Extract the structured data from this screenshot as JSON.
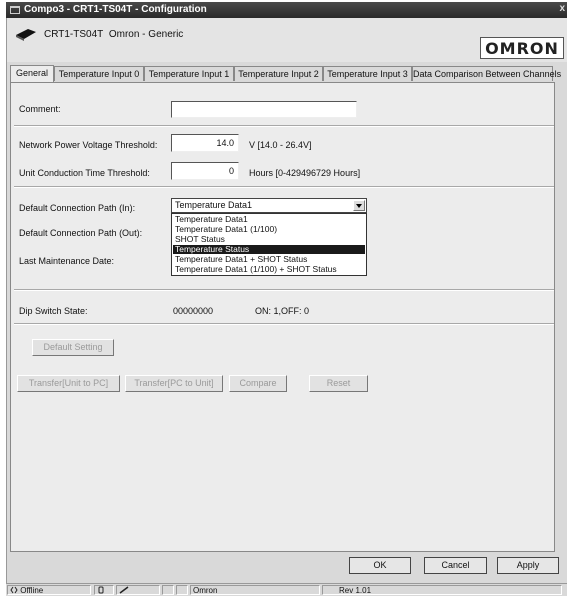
{
  "window": {
    "title": "Compo3 - CRT1-TS04T - Configuration",
    "close_glyph": "x"
  },
  "device": {
    "model": "CRT1-TS04T",
    "vendor": "Omron - Generic",
    "logo_text": "OMRON"
  },
  "tabs": [
    {
      "label": "General",
      "active": true
    },
    {
      "label": "Temperature Input 0"
    },
    {
      "label": "Temperature Input 1"
    },
    {
      "label": "Temperature Input 2"
    },
    {
      "label": "Temperature Input 3"
    },
    {
      "label": "Data Comparison Between Channels"
    }
  ],
  "general": {
    "comment": {
      "label": "Comment:",
      "value": ""
    },
    "voltage_threshold": {
      "label": "Network Power Voltage Threshold:",
      "value": "14.0",
      "unit": "V [14.0 - 26.4V]"
    },
    "conduction_threshold": {
      "label": "Unit Conduction Time Threshold:",
      "value": "0",
      "unit": "Hours [0-429496729 Hours]"
    },
    "path_in": {
      "label": "Default Connection Path (In):",
      "value": "Temperature Data1"
    },
    "path_out": {
      "label": "Default Connection Path (Out):"
    },
    "maintenance": {
      "label": "Last Maintenance Date:"
    },
    "dropdown_options": [
      "Temperature Data1",
      "Temperature Data1 (1/100)",
      "SHOT Status",
      "Temperature Status",
      "Temperature Data1 + SHOT Status",
      "Temperature Data1 (1/100) + SHOT Status"
    ],
    "dropdown_selected": "Temperature Status",
    "dip_switch": {
      "label": "Dip Switch State:",
      "value": "00000000",
      "legend": "ON: 1,OFF: 0"
    }
  },
  "buttons": {
    "default_setting": "Default Setting",
    "transfer_to_pc": "Transfer[Unit to PC]",
    "transfer_to_unit": "Transfer[PC to Unit]",
    "compare": "Compare",
    "reset": "Reset",
    "ok": "OK",
    "cancel": "Cancel",
    "apply": "Apply"
  },
  "statusbar": {
    "mode": "Offline",
    "vendor": "Omron",
    "revision": "Rev 1.01"
  }
}
